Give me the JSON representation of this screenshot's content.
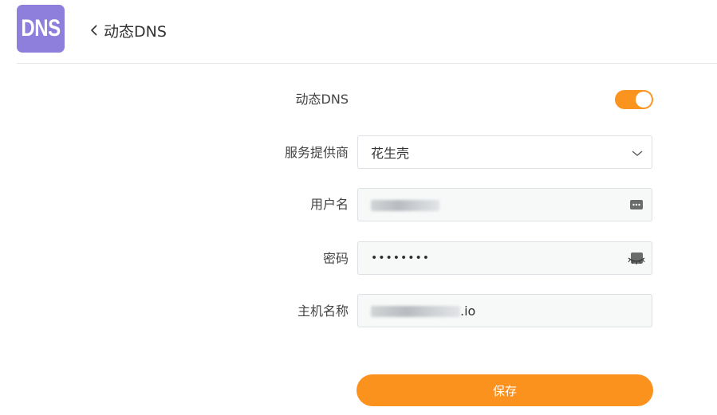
{
  "header": {
    "app_icon_text": "DNS",
    "title": "动态DNS"
  },
  "form": {
    "ddns": {
      "label": "动态DNS",
      "enabled": true
    },
    "provider": {
      "label": "服务提供商",
      "value": "花生壳"
    },
    "username": {
      "label": "用户名",
      "value": ""
    },
    "password": {
      "label": "密码",
      "value": "••••••••"
    },
    "hostname": {
      "label": "主机名称",
      "value_suffix": ".io"
    }
  },
  "actions": {
    "save_label": "保存"
  },
  "colors": {
    "accent": "#fb941f",
    "app_icon_bg": "#8e7fdd"
  },
  "icons": {
    "back": "chevron-left-icon",
    "select": "chevron-down-icon",
    "username_field": "password-manager-icon",
    "password_field": "password-hidden-icon"
  }
}
